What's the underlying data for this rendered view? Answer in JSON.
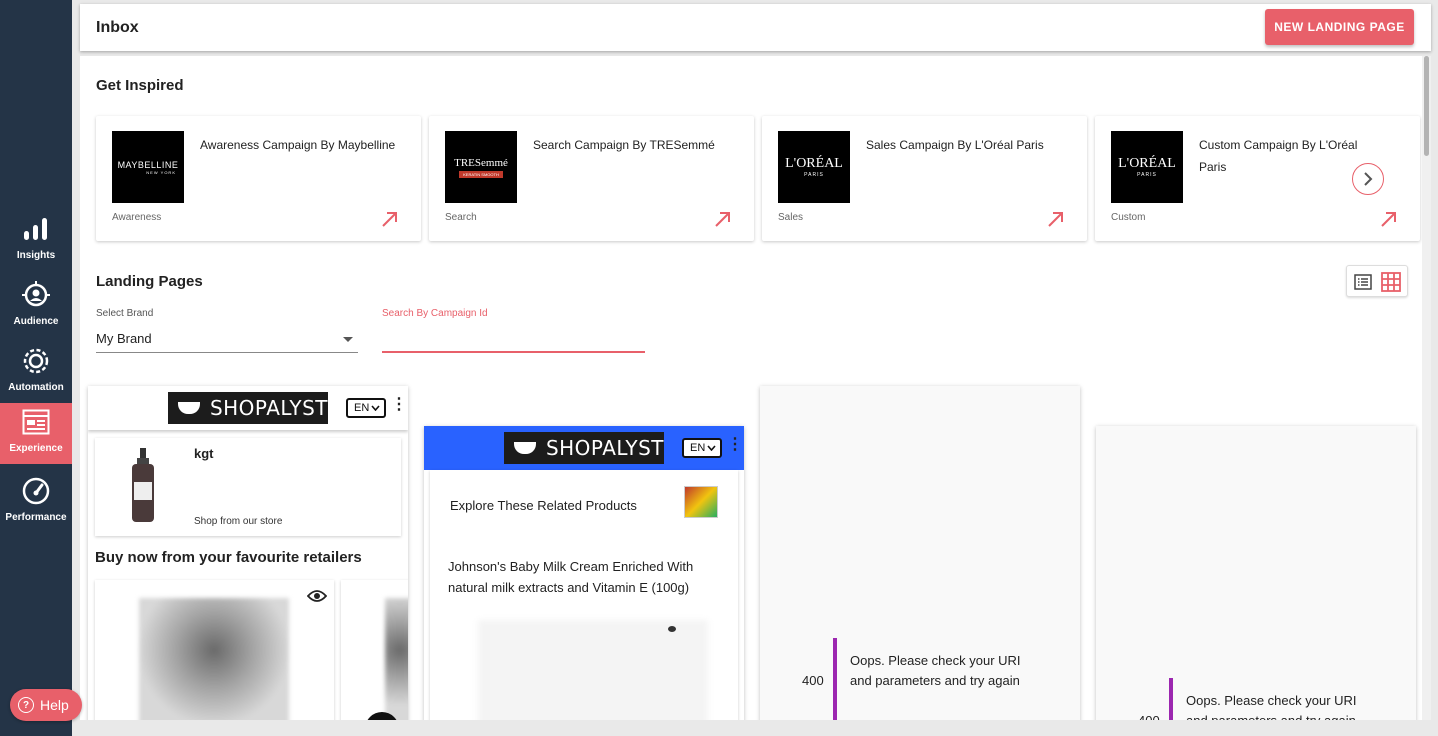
{
  "sidebar": {
    "items": [
      {
        "label": "Insights",
        "icon": "bar-chart-icon"
      },
      {
        "label": "Audience",
        "icon": "target-icon"
      },
      {
        "label": "Automation",
        "icon": "gear-icon"
      },
      {
        "label": "Experience",
        "icon": "layout-icon",
        "active": true
      },
      {
        "label": "Performance",
        "icon": "speedometer-icon"
      }
    ],
    "help_label": "Help"
  },
  "header": {
    "title": "Inbox",
    "new_button_label": "NEW LANDING PAGE"
  },
  "inspired": {
    "title": "Get Inspired",
    "cards": [
      {
        "name": "Awareness Campaign By Maybelline",
        "category": "Awareness",
        "logo_text": "MAYBELLINE",
        "logo_sub": "NEW YORK"
      },
      {
        "name": "Search Campaign By TRESemmé",
        "category": "Search",
        "logo_text": "TRESemmé",
        "logo_sub": "KERATIN SMOOTH"
      },
      {
        "name": "Sales Campaign By L'Oréal Paris",
        "category": "Sales",
        "logo_text": "L'ORÉAL",
        "logo_sub": "PARIS"
      },
      {
        "name": "Custom Campaign By L'Oréal Paris",
        "category": "Custom",
        "logo_text": "L'ORÉAL",
        "logo_sub": "PARIS"
      }
    ]
  },
  "landing_pages": {
    "title": "Landing Pages",
    "brand_label": "Select Brand",
    "brand_value": "My Brand",
    "search_label": "Search By Campaign Id",
    "search_value": ""
  },
  "previews": {
    "p1": {
      "logo": "SHOPALYST",
      "lang": "EN",
      "product_title": "kgt",
      "product_sub": "Shop from our store",
      "retailers_heading": "Buy now from your favourite retailers"
    },
    "p2": {
      "logo": "SHOPALYST",
      "lang": "EN",
      "related_heading": "Explore These Related Products",
      "product_name": "Johnson's Baby Milk Cream Enriched With natural milk extracts and Vitamin E (100g)"
    },
    "p3": {
      "code": "400",
      "message": "Oops. Please check your URI and parameters and try again"
    },
    "p4": {
      "code": "400",
      "message": "Oops. Please check your URI and parameters and try again"
    }
  },
  "colors": {
    "accent": "#e8606a",
    "sidebar": "#243447",
    "preview_header_blue": "#2962ff",
    "error_bar": "#9c27b0"
  }
}
